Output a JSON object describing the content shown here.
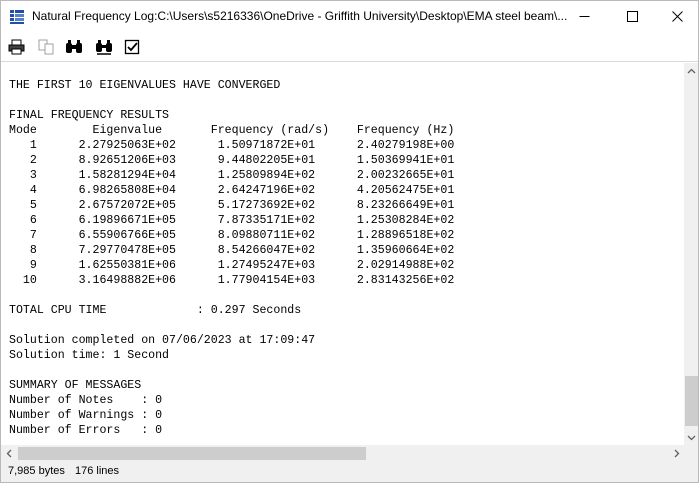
{
  "window": {
    "title": "Natural Frequency Log:C:\\Users\\s5216336\\OneDrive - Griffith University\\Desktop\\EMA steel beam\\..."
  },
  "toolbar": {
    "icons": [
      "print-icon",
      "copy-icon",
      "find-icon",
      "find-next-icon",
      "checkbox-icon"
    ]
  },
  "log": {
    "lines": [
      "THE FIRST 10 EIGENVALUES HAVE CONVERGED",
      "",
      "FINAL FREQUENCY RESULTS",
      "Mode        Eigenvalue       Frequency (rad/s)    Frequency (Hz)",
      "   1      2.27925063E+02      1.50971872E+01      2.40279198E+00",
      "   2      8.92651206E+03      9.44802205E+01      1.50369941E+01",
      "   3      1.58281294E+04      1.25809894E+02      2.00232665E+01",
      "   4      6.98265808E+04      2.64247196E+02      4.20562475E+01",
      "   5      2.67572072E+05      5.17273692E+02      8.23266649E+01",
      "   6      6.19896671E+05      7.87335171E+02      1.25308284E+02",
      "   7      6.55906766E+05      8.09880711E+02      1.28896518E+02",
      "   8      7.29770478E+05      8.54266047E+02      1.35960664E+02",
      "   9      1.62550381E+06      1.27495247E+03      2.02914988E+02",
      "  10      3.16498882E+06      1.77904154E+03      2.83143256E+02",
      "",
      "TOTAL CPU TIME             : 0.297 Seconds",
      "",
      "Solution completed on 07/06/2023 at 17:09:47",
      "Solution time: 1 Second",
      "",
      "SUMMARY OF MESSAGES",
      "Number of Notes    : 0",
      "Number of Warnings : 0",
      "Number of Errors   : 0"
    ]
  },
  "status": {
    "bytes": "7,985 bytes",
    "lines": "176 lines"
  }
}
